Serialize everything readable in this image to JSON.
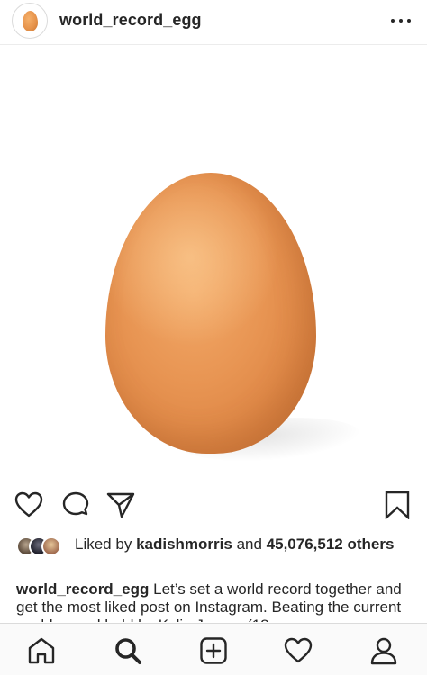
{
  "header": {
    "username": "world_record_egg"
  },
  "photo": {
    "subject": "egg"
  },
  "likes": {
    "prefix": "Liked by",
    "liked_by_user": "kadishmorris",
    "conjunction": "and",
    "count": "45,076,512",
    "suffix": "others"
  },
  "caption": {
    "username": "world_record_egg",
    "text": "Let’s set a world record together and get the most liked post on Instagram. Beating the current world record held by Kylie Jenner (18"
  },
  "icons": {
    "like": "heart-icon",
    "comment": "comment-icon",
    "share": "paper-plane-icon",
    "save": "bookmark-icon",
    "more": "more-dots-icon",
    "nav": [
      "home-icon",
      "search-icon",
      "add-post-icon",
      "activity-heart-icon",
      "profile-icon"
    ]
  },
  "colors": {
    "text": "#262626",
    "border": "#dbdbdb",
    "egg": "#e89553",
    "nav_background": "#fafafa"
  }
}
